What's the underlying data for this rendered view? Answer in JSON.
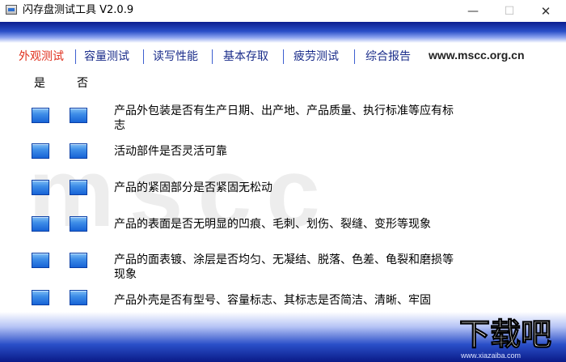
{
  "window": {
    "title": "闪存盘测试工具  V2.0.9",
    "minimize": "—",
    "maximize": "☐",
    "close": "✕"
  },
  "watermark": "mscc",
  "nav": {
    "items": [
      "外观测试",
      "容量测试",
      "读写性能",
      "基本存取",
      "疲劳测试",
      "综合报告"
    ],
    "active_index": 0,
    "site": "www.mscc.org.cn"
  },
  "columns": {
    "yes": "是",
    "no": "否"
  },
  "checklist": [
    "产品外包装是否有生产日期、出产地、产品质量、执行标准等应有标志",
    "活动部件是否灵活可靠",
    "产品的紧固部分是否紧固无松动",
    "产品的表面是否无明显的凹痕、毛刺、划伤、裂缝、变形等现象",
    "产品的面表镀、涂层是否均匀、无凝结、脱落、色差、龟裂和磨损等现象",
    "产品外壳是否有型号、容量标志、其标志是否简洁、清晰、牢固"
  ],
  "logo": {
    "main": "下载吧",
    "sub": "www.xiazaiba.com"
  },
  "colors": {
    "band_dark": "#0c1e8f",
    "active_tab": "#e0301e",
    "tab_text": "#1a2c8a",
    "checkbox": "#1763d6"
  }
}
